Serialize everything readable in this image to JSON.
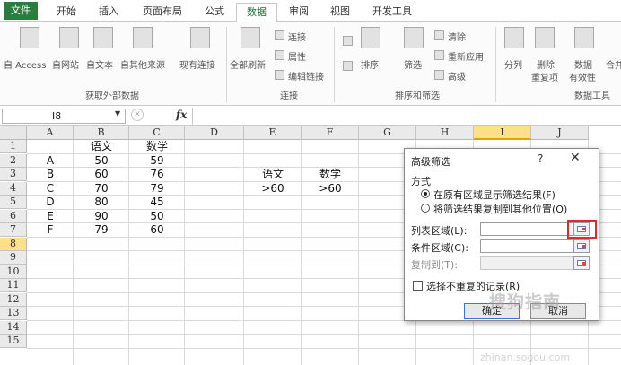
{
  "tabs": [
    "文件",
    "开始",
    "插入",
    "页面布局",
    "公式",
    "数据",
    "审阅",
    "视图",
    "开发工具"
  ],
  "ribbon": {
    "external": {
      "access": "自 Access",
      "web": "自网站",
      "text": "自文本",
      "other": "自其他来源",
      "existing": "现有连接",
      "group": "获取外部数据"
    },
    "connections": {
      "refresh_all": "全部刷新",
      "connections": "连接",
      "properties": "属性",
      "edit_links": "编辑链接",
      "group": "连接"
    },
    "sort_filter": {
      "sort": "排序",
      "filter": "筛选",
      "clear": "清除",
      "reapply": "重新应用",
      "advanced": "高级",
      "group": "排序和筛选"
    },
    "tools": {
      "text_to_columns": "分列",
      "remove_dup_1": "删除",
      "remove_dup_2": "重复项",
      "validation_1": "数据",
      "validation_2": "有效性",
      "consolidate": "合并",
      "group": "数据工具"
    }
  },
  "formula_bar": {
    "name_box": "I8",
    "fx": "fx"
  },
  "columns": [
    "A",
    "B",
    "C",
    "D",
    "E",
    "F",
    "G",
    "H",
    "I",
    "J"
  ],
  "selected_column": "I",
  "rows": [
    "1",
    "2",
    "3",
    "4",
    "5",
    "6",
    "7",
    "8",
    "9",
    "10",
    "11",
    "12",
    "13",
    "14",
    "15"
  ],
  "selected_row": "8",
  "cells": {
    "B1": "语文",
    "C1": "数学",
    "A2": "A",
    "B2": "50",
    "C2": "59",
    "A3": "B",
    "B3": "60",
    "C3": "76",
    "A4": "C",
    "B4": "70",
    "C4": "79",
    "A5": "D",
    "B5": "80",
    "C5": "45",
    "A6": "E",
    "B6": "90",
    "C6": "50",
    "A7": "F",
    "B7": "79",
    "C7": "60",
    "E3": "语文",
    "F3": "数学",
    "E4": ">60",
    "F4": ">60"
  },
  "dialog": {
    "title": "高级筛选",
    "help": "?",
    "close": "✕",
    "mode_label": "方式",
    "option_in_place": "在原有区域显示筛选结果(F)",
    "option_copy": "将筛选结果复制到其他位置(O)",
    "list_range": "列表区域(L):",
    "criteria_range": "条件区域(C):",
    "copy_to": "复制到(T):",
    "unique": "选择不重复的记录(R)",
    "ok": "确定",
    "cancel": "取消"
  },
  "watermark": {
    "brand": "搜狗指南",
    "url": "zhinan.sogou.com"
  }
}
